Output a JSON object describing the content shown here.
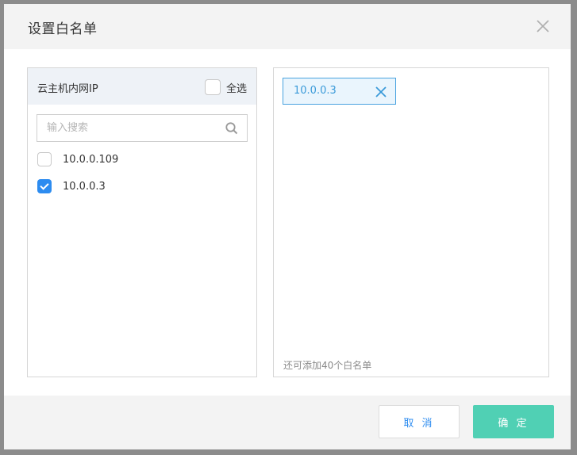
{
  "dialog": {
    "title": "设置白名单"
  },
  "left_panel": {
    "title": "云主机内网IP",
    "select_all_label": "全选",
    "search_placeholder": "输入搜索",
    "items": [
      {
        "ip": "10.0.0.109",
        "checked": false
      },
      {
        "ip": "10.0.0.3",
        "checked": true
      }
    ]
  },
  "right_panel": {
    "selected_tags": [
      {
        "ip": "10.0.0.3"
      }
    ],
    "remaining_text": "还可添加40个白名单"
  },
  "footer": {
    "cancel_label": "取 消",
    "confirm_label": "确 定"
  },
  "colors": {
    "accent_blue": "#2d8cf0",
    "tag_border": "#4aa3df",
    "confirm_button": "#50d0b4"
  }
}
